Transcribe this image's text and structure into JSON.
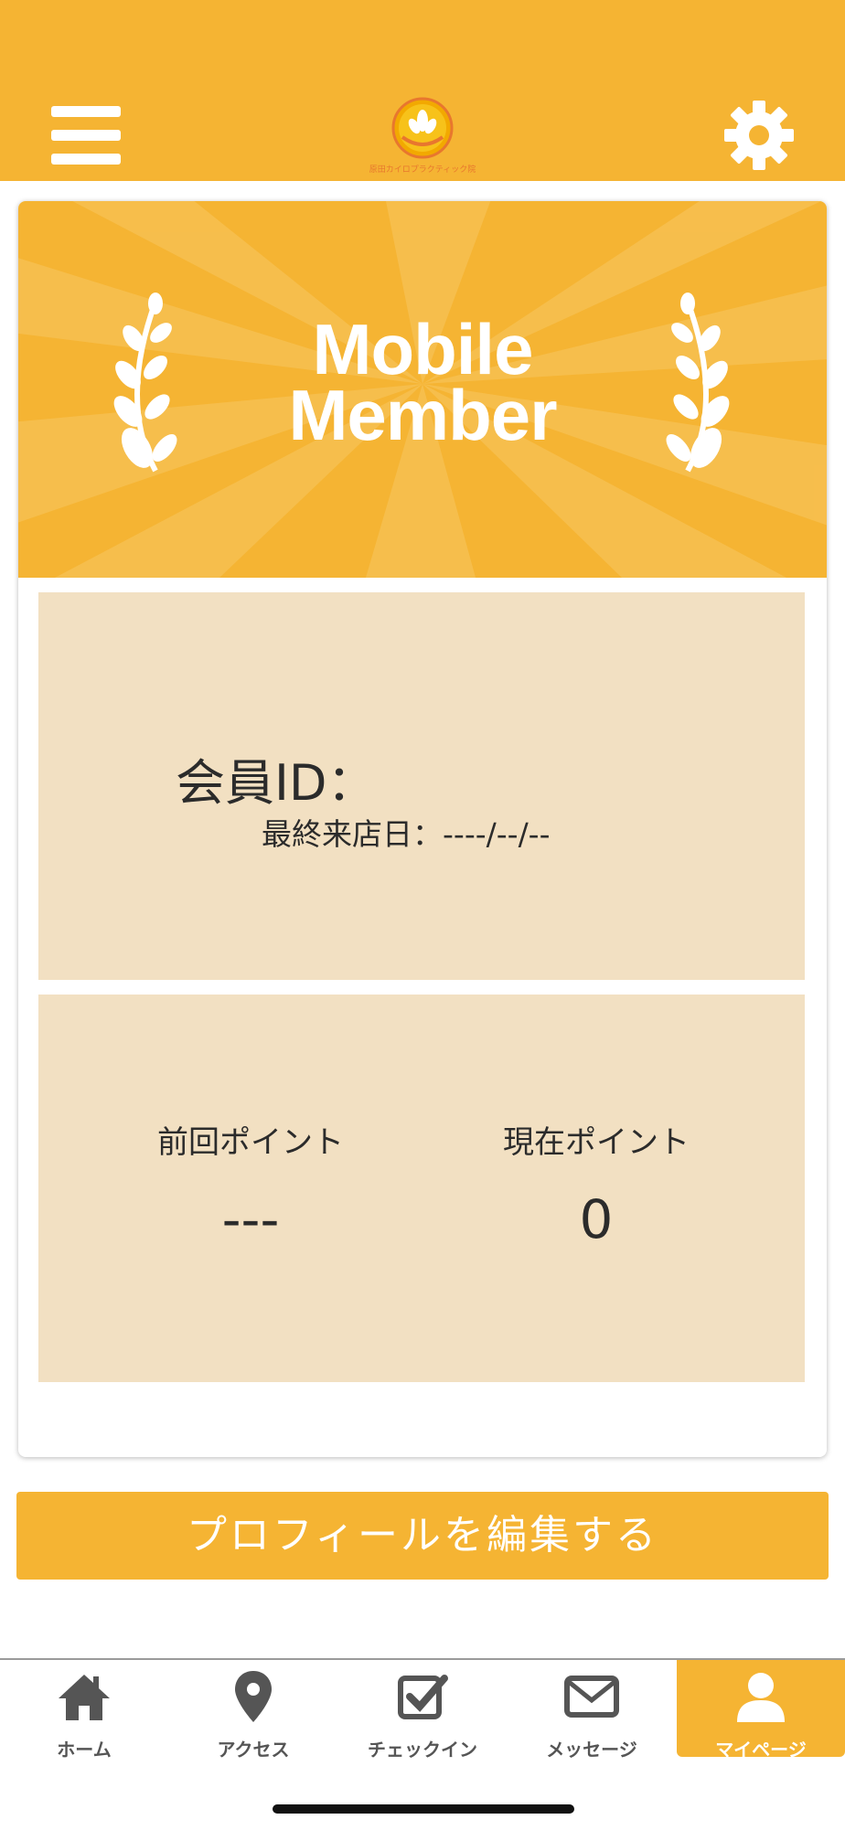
{
  "header": {
    "logo_text": "原田カイロプラクティック院"
  },
  "banner": {
    "line1": "Mobile",
    "line2": "Member"
  },
  "member": {
    "id_label": "会員ID：",
    "last_visit_label": "最終来店日：----/--/--"
  },
  "points": {
    "previous_label": "前回ポイント",
    "previous_value": "---",
    "current_label": "現在ポイント",
    "current_value": "0"
  },
  "edit_button": "プロフィールを編集する",
  "tabs": [
    {
      "label": "ホーム",
      "icon": "home-icon"
    },
    {
      "label": "アクセス",
      "icon": "map-pin-icon"
    },
    {
      "label": "チェックイン",
      "icon": "checkbox-icon"
    },
    {
      "label": "メッセージ",
      "icon": "envelope-icon"
    },
    {
      "label": "マイページ",
      "icon": "user-icon"
    }
  ],
  "colors": {
    "brand": "#F5B433",
    "panel": "#F2E0C2",
    "text": "#2b2b2b"
  }
}
